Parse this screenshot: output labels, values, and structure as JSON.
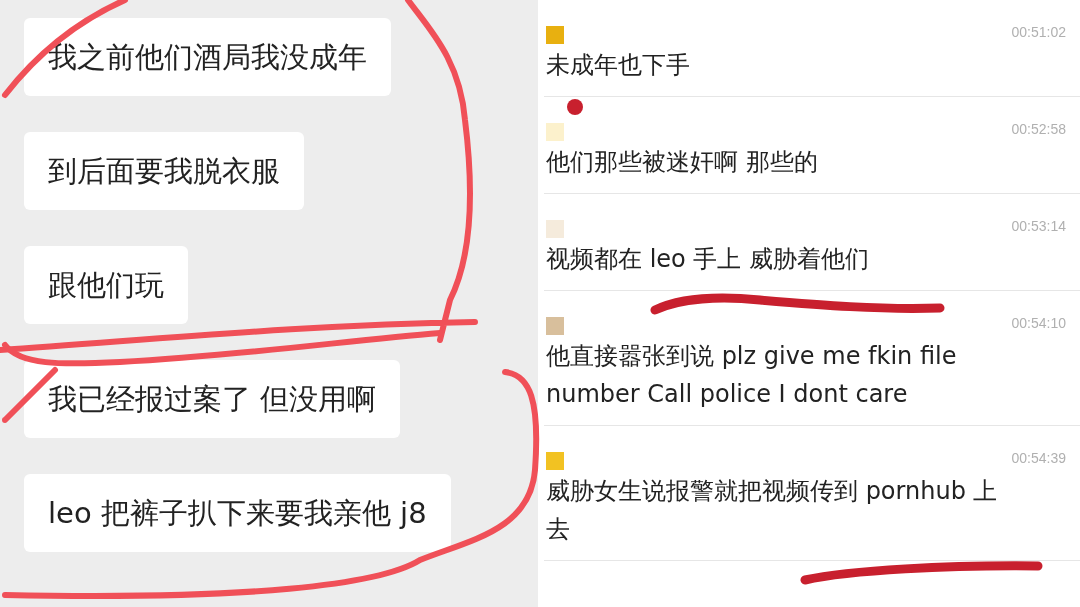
{
  "left_chat": {
    "messages": [
      {
        "text": "我之前他们酒局我没成年"
      },
      {
        "text": "到后面要我脱衣服"
      },
      {
        "text": "跟他们玩"
      },
      {
        "text": "我已经报过案了 但没用啊"
      },
      {
        "text": "leo 把裤子扒下来要我亲他 j8"
      }
    ]
  },
  "right_chat": {
    "entries": [
      {
        "color": "#e8b010",
        "time": "00:51:02",
        "text": "未成年也下手"
      },
      {
        "color": "#fcf1cc",
        "time": "00:52:58",
        "text": "他们那些被迷奸啊 那些的"
      },
      {
        "color": "#f5ebdc",
        "time": "00:53:14",
        "text": "视频都在 leo 手上 威胁着他们"
      },
      {
        "color": "#d8bf9c",
        "time": "00:54:10",
        "text": "他直接嚣张到说 plz give me fkin file number Call police I dont care"
      },
      {
        "color": "#f2c222",
        "time": "00:54:39",
        "text": "威胁女生说报警就把视频传到 pornhub 上去"
      }
    ]
  }
}
